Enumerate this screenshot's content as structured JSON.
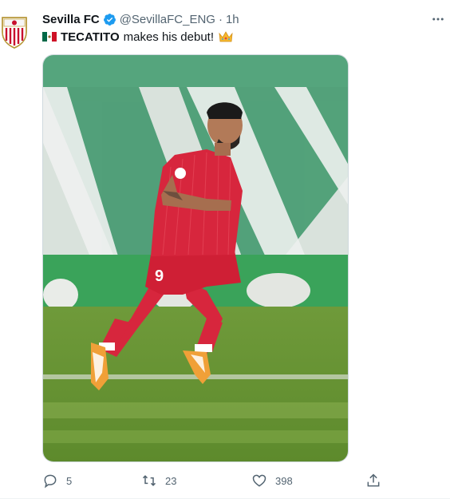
{
  "tweet": {
    "author_name": "Sevilla FC",
    "handle": "@SevillaFC_ENG",
    "separator": "·",
    "time": "1h",
    "text_bold": "TECATITO",
    "text_rest": "makes his debut!",
    "flag_icon": "mexico-flag-icon",
    "crown_icon": "crown-emoji-icon",
    "verified_color": "#1d9bf0"
  },
  "media": {
    "player_number": "9",
    "description_icon": "player-photo"
  },
  "actions": {
    "reply_count": "5",
    "retweet_count": "23",
    "like_count": "398"
  }
}
